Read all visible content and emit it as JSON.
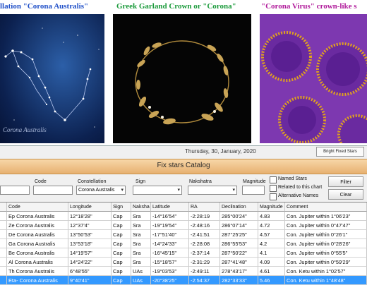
{
  "banner": {
    "captions": [
      {
        "text": "llation \"Corona Australis\"",
        "color": "#2050c8"
      },
      {
        "text": "Greek Garland Crown or \"Corona\"",
        "color": "#1a9a3a"
      },
      {
        "text": "\"Corona Virus\" crown-like s",
        "color": "#b01a9a"
      }
    ],
    "watermark": "Corona Australis"
  },
  "background": {
    "date": "Thursday, 30, January, 2020",
    "top_button": "Bright Fixed Stars"
  },
  "window": {
    "title": "Fix stars Catalog",
    "filters": {
      "code_label": "Code",
      "constellation_label": "Constellation",
      "constellation_value": "Corona Australis",
      "sign_label": "Sign",
      "nakshatra_label": "Nakshatra",
      "magnitude_label": "Magnitude"
    },
    "checkboxes": [
      "Named Stars",
      "Related to this chart",
      "Alternative Names"
    ],
    "buttons": {
      "filter": "Filter",
      "clear": "Clear"
    }
  },
  "table": {
    "columns": [
      "Name",
      "Code",
      "Longitude",
      "Sign",
      "Naksha",
      "Latitude",
      "RA",
      "Declination",
      "Magnitude",
      "Comment"
    ],
    "rows": [
      [
        "",
        "Ep Corona Australis",
        "12°18'28\"",
        "Cap",
        "Sra",
        "-14°16'54\"",
        "-2:28:19",
        "285°00'24\"",
        "4.83",
        "Con. Jupiter within 1°06'23\""
      ],
      [
        "",
        "Ze Corona Australis",
        "12°37'4\"",
        "Cap",
        "Sra",
        "-19°19'54\"",
        "-2:48:16",
        "286°07'14\"",
        "4.72",
        "Con. Jupiter within 0°47'47\""
      ],
      [
        "",
        "De Corona Australis",
        "13°50'53\"",
        "Cap",
        "Sra",
        "-17°51'40\"",
        "-2:41:51",
        "287°25'25\"",
        "4.57",
        "Con. Jupiter within 0°26'1\""
      ],
      [
        "",
        "Ga Corona Australis",
        "13°53'18\"",
        "Cap",
        "Sra",
        "-14°24'33\"",
        "-2:28:08",
        "286°55'53\"",
        "4.2",
        "Con. Jupiter within 0°28'26\""
      ],
      [
        "",
        "Be Corona Australis",
        "14°19'57\"",
        "Cap",
        "Sra",
        "-16°45'15\"",
        "-2:37:14",
        "287°50'22\"",
        "4.1",
        "Con. Jupiter within 0°55'5\""
      ],
      [
        "",
        "Al Corona Australis",
        "14°24'22\"",
        "Cap",
        "Sra",
        "-15°18'57\"",
        "-2:31:29",
        "287°41'48\"",
        "4.09",
        "Con. Jupiter within 0°59'29\""
      ],
      [
        "",
        "Th Corona Australis",
        "6°48'55\"",
        "Cap",
        "UAs",
        "-19°03'53\"",
        "-2:49:11",
        "278°43'17\"",
        "4.61",
        "Con. Ketu within 1°02'57\""
      ],
      [
        "",
        "Eta- Corona Australis",
        "9°40'41\"",
        "Cap",
        "UAs",
        "-20°38'25\"",
        "-2:54:37",
        "282°33'33\"",
        "5.46",
        "Con. Ketu within 1°48'48\""
      ]
    ]
  }
}
